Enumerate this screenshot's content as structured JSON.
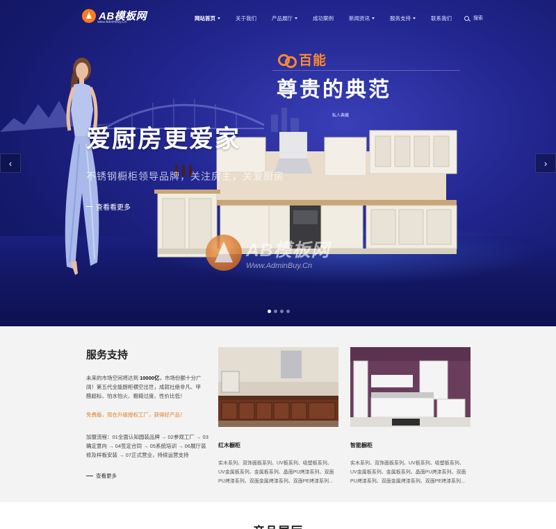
{
  "nav": {
    "logo_text": "AB模板网",
    "logo_sub": "www.AdminBuy.Cn",
    "items": [
      {
        "label": "网站首页",
        "dropdown": true,
        "active": true
      },
      {
        "label": "关于我们",
        "dropdown": false
      },
      {
        "label": "产品展厅",
        "dropdown": true
      },
      {
        "label": "成功案例",
        "dropdown": false
      },
      {
        "label": "新闻资讯",
        "dropdown": true
      },
      {
        "label": "服务支持",
        "dropdown": true
      },
      {
        "label": "联系我们",
        "dropdown": false
      }
    ],
    "search_label": "搜索"
  },
  "banner": {
    "brand_name": "百能",
    "slogan": "尊贵的典范",
    "title": "爱厨房更爱家",
    "subtitle": "不锈钢橱柜领导品牌，关注房主，关爱厨房",
    "more_label": "查看看更多",
    "mini_title": "私人典藏",
    "prev_arrow": "‹",
    "next_arrow": "›",
    "watermark_big": "AB模板网",
    "watermark_small": "Www.AdminBuy.Cn",
    "slide_count": 4,
    "active_slide": 0
  },
  "service": {
    "title": "服务支持",
    "paragraph_prefix": "未来的市场空间将达到 ",
    "paragraph_number": "10000亿",
    "paragraph_suffix": "，市场份额十分广阔！第五代全能厨柜横空出世，成就社绝非凡、甲醛超标、怕水怕火、粗糙过度、性价比低！",
    "highlight": "免费版，现在升级授权工厂，获得好产品！",
    "process": "加盟流程：01全面认知圆装品牌 → 02参观工厂 → 03确定意向 → 04签定合同 → 05系统培训 → 06展厅装修及样板安装 → 07正式营业，持续运营支持",
    "more_label": "查看更多",
    "cards": [
      {
        "title": "红木橱柜",
        "desc": "实木系列、双饰面板系列、UV板系列、吸塑板系列、UV金属板系列、金属板系列、晶面PU烤漆系列、双面PU烤漆系列、双面金属烤漆系列、双面PE烤漆系列..."
      },
      {
        "title": "智能橱柜",
        "desc": "实木系列、双饰面板系列、UV板系列、吸塑板系列、UV金属板系列、金属板系列、晶面PU烤漆系列、双面PU烤漆系列、双面金属烤漆系列、双面PE烤漆系列..."
      }
    ]
  },
  "products": {
    "title": "产品展厅"
  }
}
